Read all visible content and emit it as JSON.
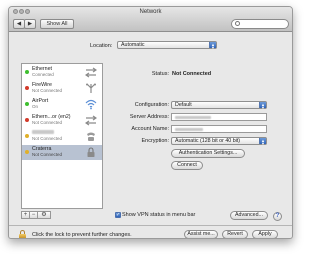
{
  "window": {
    "title": "Network",
    "nav": {
      "back_icon": "back-arrow-icon",
      "forward_icon": "forward-arrow-icon",
      "show_all_label": "Show All"
    },
    "search": {
      "placeholder": "",
      "icon": "magnifier-icon"
    }
  },
  "location": {
    "label": "Location:",
    "value": "Automatic"
  },
  "sidebar": {
    "services": [
      {
        "name": "Ethernet",
        "status": "Connected",
        "status_color": "#3fbf2f",
        "icon": "ethernet-arrows-icon"
      },
      {
        "name": "FireWire",
        "status": "Not Connected",
        "status_color": "#d23a2a",
        "icon": "firewire-icon"
      },
      {
        "name": "AirPort",
        "status": "On",
        "status_color": "#3fbf2f",
        "icon": "wifi-icon"
      },
      {
        "name": "Ethern...or (en2)",
        "status": "Not Connected",
        "status_color": "#d23a2a",
        "icon": "ethernet-arrows-icon"
      },
      {
        "name": "",
        "status": "Not Connected",
        "status_color": "#e0b02a",
        "icon": "phone-icon"
      },
      {
        "name": "Craterra",
        "status": "Not Connected",
        "status_color": "#e0b02a",
        "icon": "vpn-lock-icon"
      }
    ],
    "selected_index": 5,
    "tools": {
      "add": "+",
      "remove": "−",
      "action": "⚙"
    }
  },
  "detail": {
    "status_label": "Status:",
    "status_value": "Not Connected",
    "configuration_label": "Configuration:",
    "configuration_value": "Default",
    "server_address_label": "Server Address:",
    "server_address_value": "",
    "account_name_label": "Account Name:",
    "account_name_value": "",
    "encryption_label": "Encryption:",
    "encryption_value": "Automatic (128 bit or 40 bit)",
    "auth_button": "Authentication Settings...",
    "connect_button": "Connect"
  },
  "footer": {
    "vpn_checkbox_label": "Show VPN status in menu bar",
    "vpn_checked": true,
    "advanced_button": "Advanced...",
    "help_button": "?",
    "lock_text": "Click the lock to prevent further changes.",
    "assist_button": "Assist me...",
    "revert_button": "Revert",
    "apply_button": "Apply"
  },
  "colors": {
    "accent": "#2d62b8",
    "selection": "#b8c2d2"
  }
}
